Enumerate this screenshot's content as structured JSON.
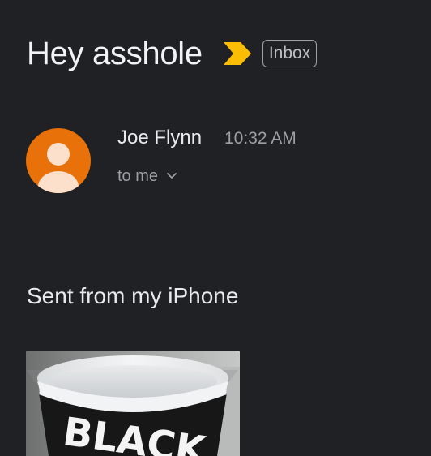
{
  "message": {
    "subject": "Hey asshole",
    "label": "Inbox",
    "importance_icon": "importance-marker-icon",
    "sender": {
      "name": "Joe Flynn",
      "time": "10:32 AM",
      "recipient": "to me",
      "avatar_icon": "person-icon",
      "avatar_color": "#e8710a"
    },
    "body": "Sent from my iPhone",
    "attachment": {
      "mug_text": "BLACK"
    }
  },
  "colors": {
    "background": "#202124",
    "primary_text": "#e8eaed",
    "secondary_text": "#9aa0a6",
    "importance": "#fbbc04"
  }
}
